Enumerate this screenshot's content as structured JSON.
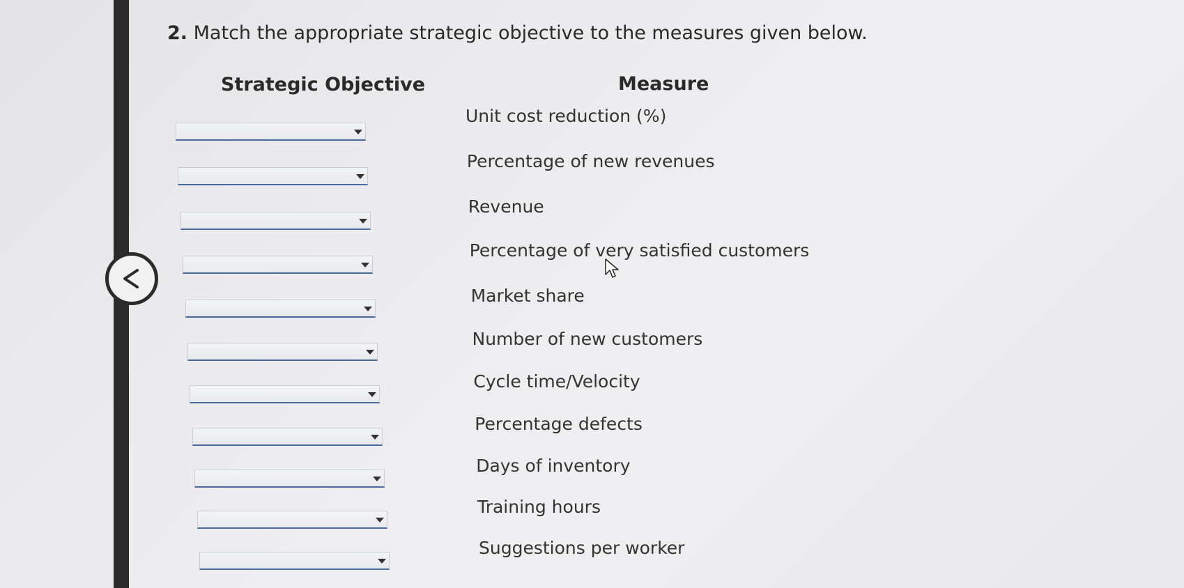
{
  "question": {
    "number": "2.",
    "text": "Match the appropriate strategic objective to the measures given below."
  },
  "headers": {
    "objective": "Strategic Objective",
    "measure": "Measure"
  },
  "rows": [
    {
      "selected": "",
      "measure": "Unit cost reduction (%)"
    },
    {
      "selected": "",
      "measure": "Percentage of new revenues"
    },
    {
      "selected": "",
      "measure": "Revenue"
    },
    {
      "selected": "",
      "measure": "Percentage of very satisfied customers"
    },
    {
      "selected": "",
      "measure": "Market share"
    },
    {
      "selected": "",
      "measure": "Number of new customers"
    },
    {
      "selected": "",
      "measure": "Cycle time/Velocity"
    },
    {
      "selected": "",
      "measure": "Percentage defects"
    },
    {
      "selected": "",
      "measure": "Days of inventory"
    },
    {
      "selected": "",
      "measure": "Training hours"
    },
    {
      "selected": "",
      "measure": "Suggestions per worker"
    }
  ],
  "icons": {
    "back": "chevron-left-icon",
    "dropdown": "caret-down-icon",
    "cursor": "mouse-pointer-icon"
  },
  "colors": {
    "select_underline": "#4a6a9a",
    "sidebar": "#2b2b2b"
  }
}
